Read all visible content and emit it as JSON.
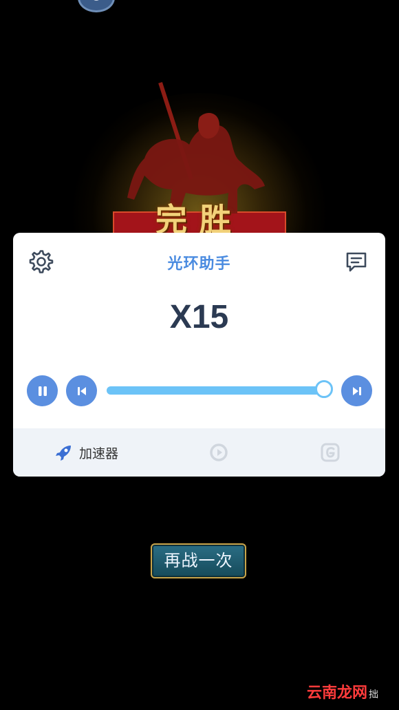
{
  "victory": {
    "text": "完胜"
  },
  "card": {
    "title": "光环助手",
    "speed_label": "X15",
    "progress": 1.0
  },
  "footer": {
    "booster_label": "加速器"
  },
  "retry_button": {
    "label": "再战一次"
  },
  "watermark": {
    "text": "云南龙网",
    "suffix": "拙"
  },
  "colors": {
    "accent": "#4a8be0",
    "button": "#5b8fe0",
    "slider": "#6cc3f7"
  }
}
